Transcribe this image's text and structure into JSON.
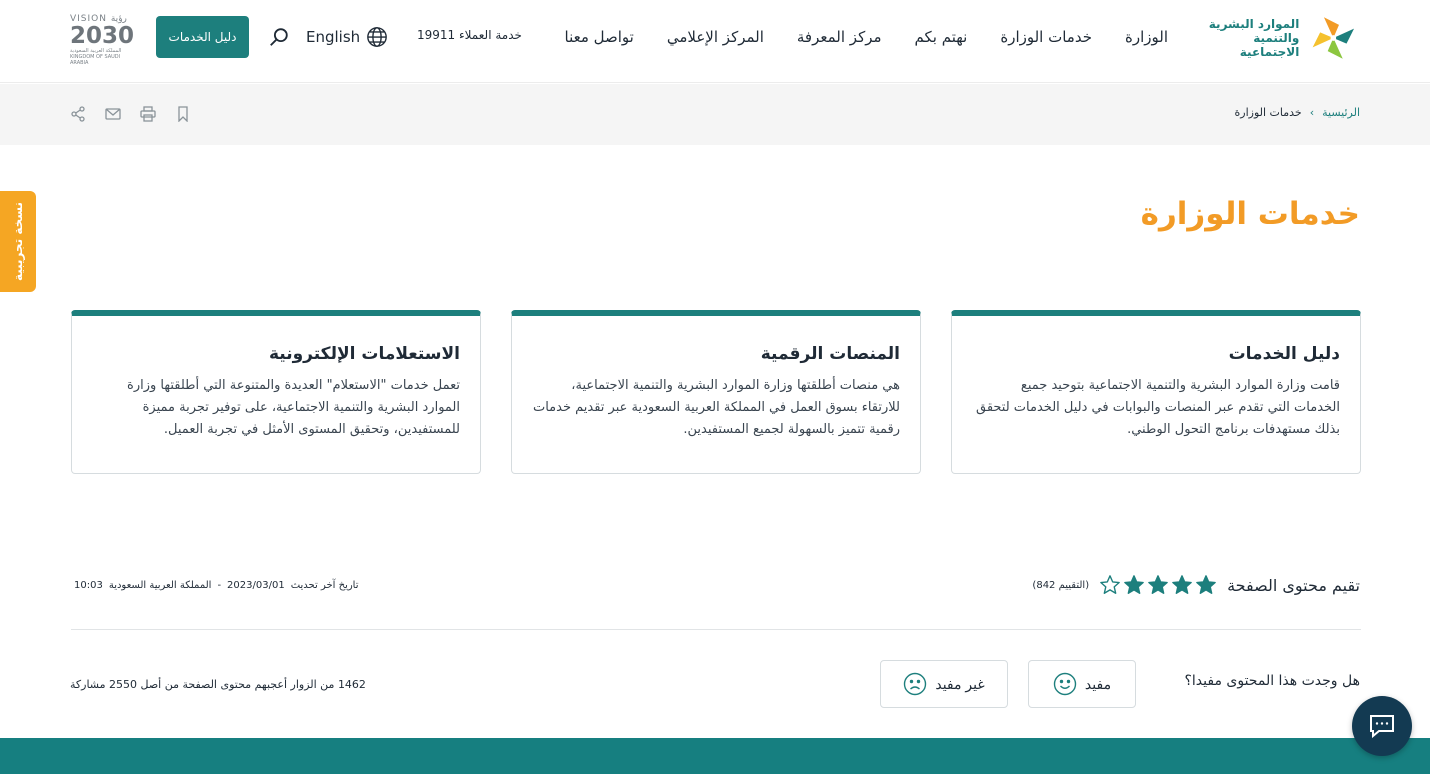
{
  "header": {
    "logo": {
      "line1": "الموارد البشرية",
      "line2": "والتنمية الاجتماعية"
    },
    "nav": [
      {
        "label": "الوزارة"
      },
      {
        "label": "خدمات الوزارة"
      },
      {
        "label": "نهتم بكم"
      },
      {
        "label": "مركز المعرفة"
      },
      {
        "label": "المركز الإعلامي"
      },
      {
        "label": "تواصل معنا"
      }
    ],
    "customer_service": "خدمة العملاء 19911",
    "language_label": "English",
    "guide_button": "دليل الخدمات",
    "vision": {
      "top": "VISION رؤية",
      "year": "2030",
      "sub1": "المملكة العربية السعودية",
      "sub2": "KINGDOM OF SAUDI ARABIA"
    }
  },
  "breadcrumb": {
    "home": "الرئيسية",
    "separator": "›",
    "current": "خدمات الوزارة"
  },
  "beta_tab": "نسخة تجريبية",
  "page_title": "خدمات الوزارة",
  "cards": [
    {
      "title": "دليل الخدمات",
      "body": "قامت وزارة الموارد البشرية والتنمية الاجتماعية بتوحيد جميع الخدمات التي تقدم عبر المنصات والبوابات في دليل الخدمات لتحقق بذلك مستهدفات برنامج التحول الوطني."
    },
    {
      "title": "المنصات الرقمية",
      "body": "هي منصات أطلقتها وزارة الموارد البشرية والتنمية الاجتماعية، للارتقاء بسوق العمل في المملكة العربية السعودية عبر تقديم خدمات رقمية تتميز بالسهولة لجميع المستفيدين."
    },
    {
      "title": "الاستعلامات الإلكترونية",
      "body": "تعمل خدمات \"الاستعلام\" العديدة والمتنوعة التي أطلقتها وزارة الموارد البشرية والتنمية الاجتماعية، على توفير تجربة مميزة للمستفيدين، وتحقيق المستوى الأمثل في تجربة العميل."
    }
  ],
  "rating": {
    "label": "تقيم محتوى الصفحة",
    "stars_filled": 4,
    "stars_total": 5,
    "count_text": "(التقييم 842)"
  },
  "last_update": {
    "label": "تاريخ آخر تحديث",
    "date": "2023/03/01",
    "separator": "-",
    "region": "المملكة العربية السعودية",
    "time": "10:03"
  },
  "feedback": {
    "question": "هل وجدت هذا المحتوى مفيدا؟",
    "yes_label": "مفيد",
    "no_label": "غير مفيد",
    "stats": "1462 من الزوار أعجبهم محتوى الصفحة من أصل 2550 مشاركة"
  },
  "colors": {
    "primary": "#1d7f7d",
    "accent": "#f29b26",
    "beta": "#f5a623",
    "chat": "#133a52"
  },
  "icons": [
    "globe-icon",
    "search-icon",
    "bookmark-icon",
    "print-icon",
    "mail-icon",
    "share-icon",
    "star-icon",
    "smile-icon",
    "frown-icon",
    "chat-icon"
  ]
}
